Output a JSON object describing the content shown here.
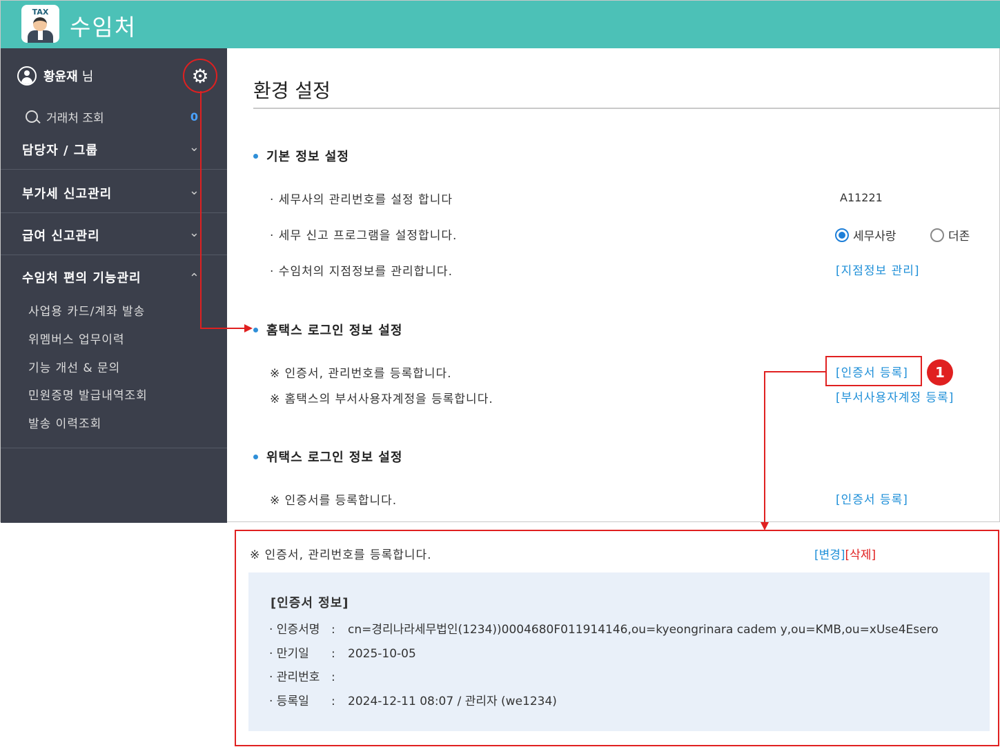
{
  "app": {
    "title": "수임처",
    "logo_text": "TAX"
  },
  "sidebar": {
    "user_name": "황윤재",
    "user_suffix": "님",
    "search_label": "거래처 조회",
    "search_count": "0",
    "menus": [
      {
        "label": "담당자 / 그룹",
        "chevron": "down"
      },
      {
        "label": "부가세 신고관리",
        "chevron": "down"
      },
      {
        "label": "급여 신고관리",
        "chevron": "down"
      },
      {
        "label": "수임처 편의 기능관리",
        "chevron": "up"
      }
    ],
    "sub_items": [
      "사업용 카드/계좌 발송",
      "위멤버스 업무이력",
      "기능 개선 & 문의",
      "민원증명 발급내역조회",
      "발송 이력조회"
    ]
  },
  "main": {
    "page_title": "환경 설정",
    "sections": {
      "basic": {
        "title": "기본 정보 설정",
        "row1": "· 세무사의 관리번호를 설정 합니다",
        "row1_value": "A11221",
        "row2": "· 세무 신고 프로그램을 설정합니다.",
        "radio1": "세무사랑",
        "radio2": "더존",
        "radio_selected": "세무사랑",
        "row3": "· 수임처의 지점정보를 관리합니다.",
        "row3_link": "[지점정보 관리]"
      },
      "hometax": {
        "title": "홈택스 로그인 정보 설정",
        "row1": "※ 인증서, 관리번호를 등록합니다.",
        "row1_link": "[인증서 등록]",
        "row2": "※ 홈택스의 부서사용자계정을 등록합니다.",
        "row2_link": "[부서사용자계정 등록]",
        "badge": "1"
      },
      "wetax": {
        "title": "위택스 로그인 정보 설정",
        "row1": "※ 인증서를 등록합니다.",
        "row1_link": "[인증서 등록]"
      }
    }
  },
  "detail": {
    "desc": "※ 인증서, 관리번호를 등록합니다.",
    "change_link": "[변경]",
    "delete_link": "[삭제]",
    "info_title": "[인증서 정보]",
    "rows": [
      {
        "key": "· 인증서명",
        "value": "cn=경리나라세무법인(1234))0004680F011914146,ou=kyeongrinara cadem y,ou=KMB,ou=xUse4Esero"
      },
      {
        "key": "· 만기일",
        "value": "2025-10-05"
      },
      {
        "key": "· 관리번호",
        "value": ""
      },
      {
        "key": "· 등록일",
        "value": "2024-12-11 08:07 / 관리자 (we1234)"
      }
    ]
  },
  "colors": {
    "header": "#4cc1b7",
    "sidebar": "#3b3f4b",
    "link": "#1e8fd8",
    "highlight": "#e02020",
    "info_bg": "#e9f0f9"
  }
}
